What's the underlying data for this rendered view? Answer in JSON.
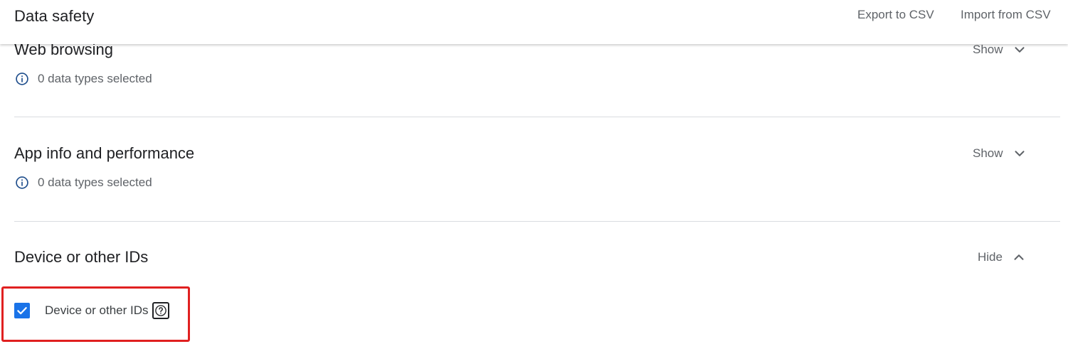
{
  "header": {
    "title": "Data safety",
    "export_label": "Export to CSV",
    "import_label": "Import from CSV"
  },
  "sections": [
    {
      "title": "Web browsing",
      "toggle": "Show",
      "summary": "0 data types selected"
    },
    {
      "title": "App info and performance",
      "toggle": "Show",
      "summary": "0 data types selected"
    },
    {
      "title": "Device or other IDs",
      "toggle": "Hide"
    }
  ],
  "device_ids": {
    "checkbox_label": "Device or other IDs",
    "checked": true
  },
  "colors": {
    "accent": "#1a73e8",
    "highlight": "#e02020",
    "text_secondary": "#5f6368",
    "divider": "#dadce0"
  },
  "icons": [
    "info-icon",
    "chevron-down-icon",
    "chevron-up-icon",
    "checkmark-icon",
    "help-icon"
  ]
}
